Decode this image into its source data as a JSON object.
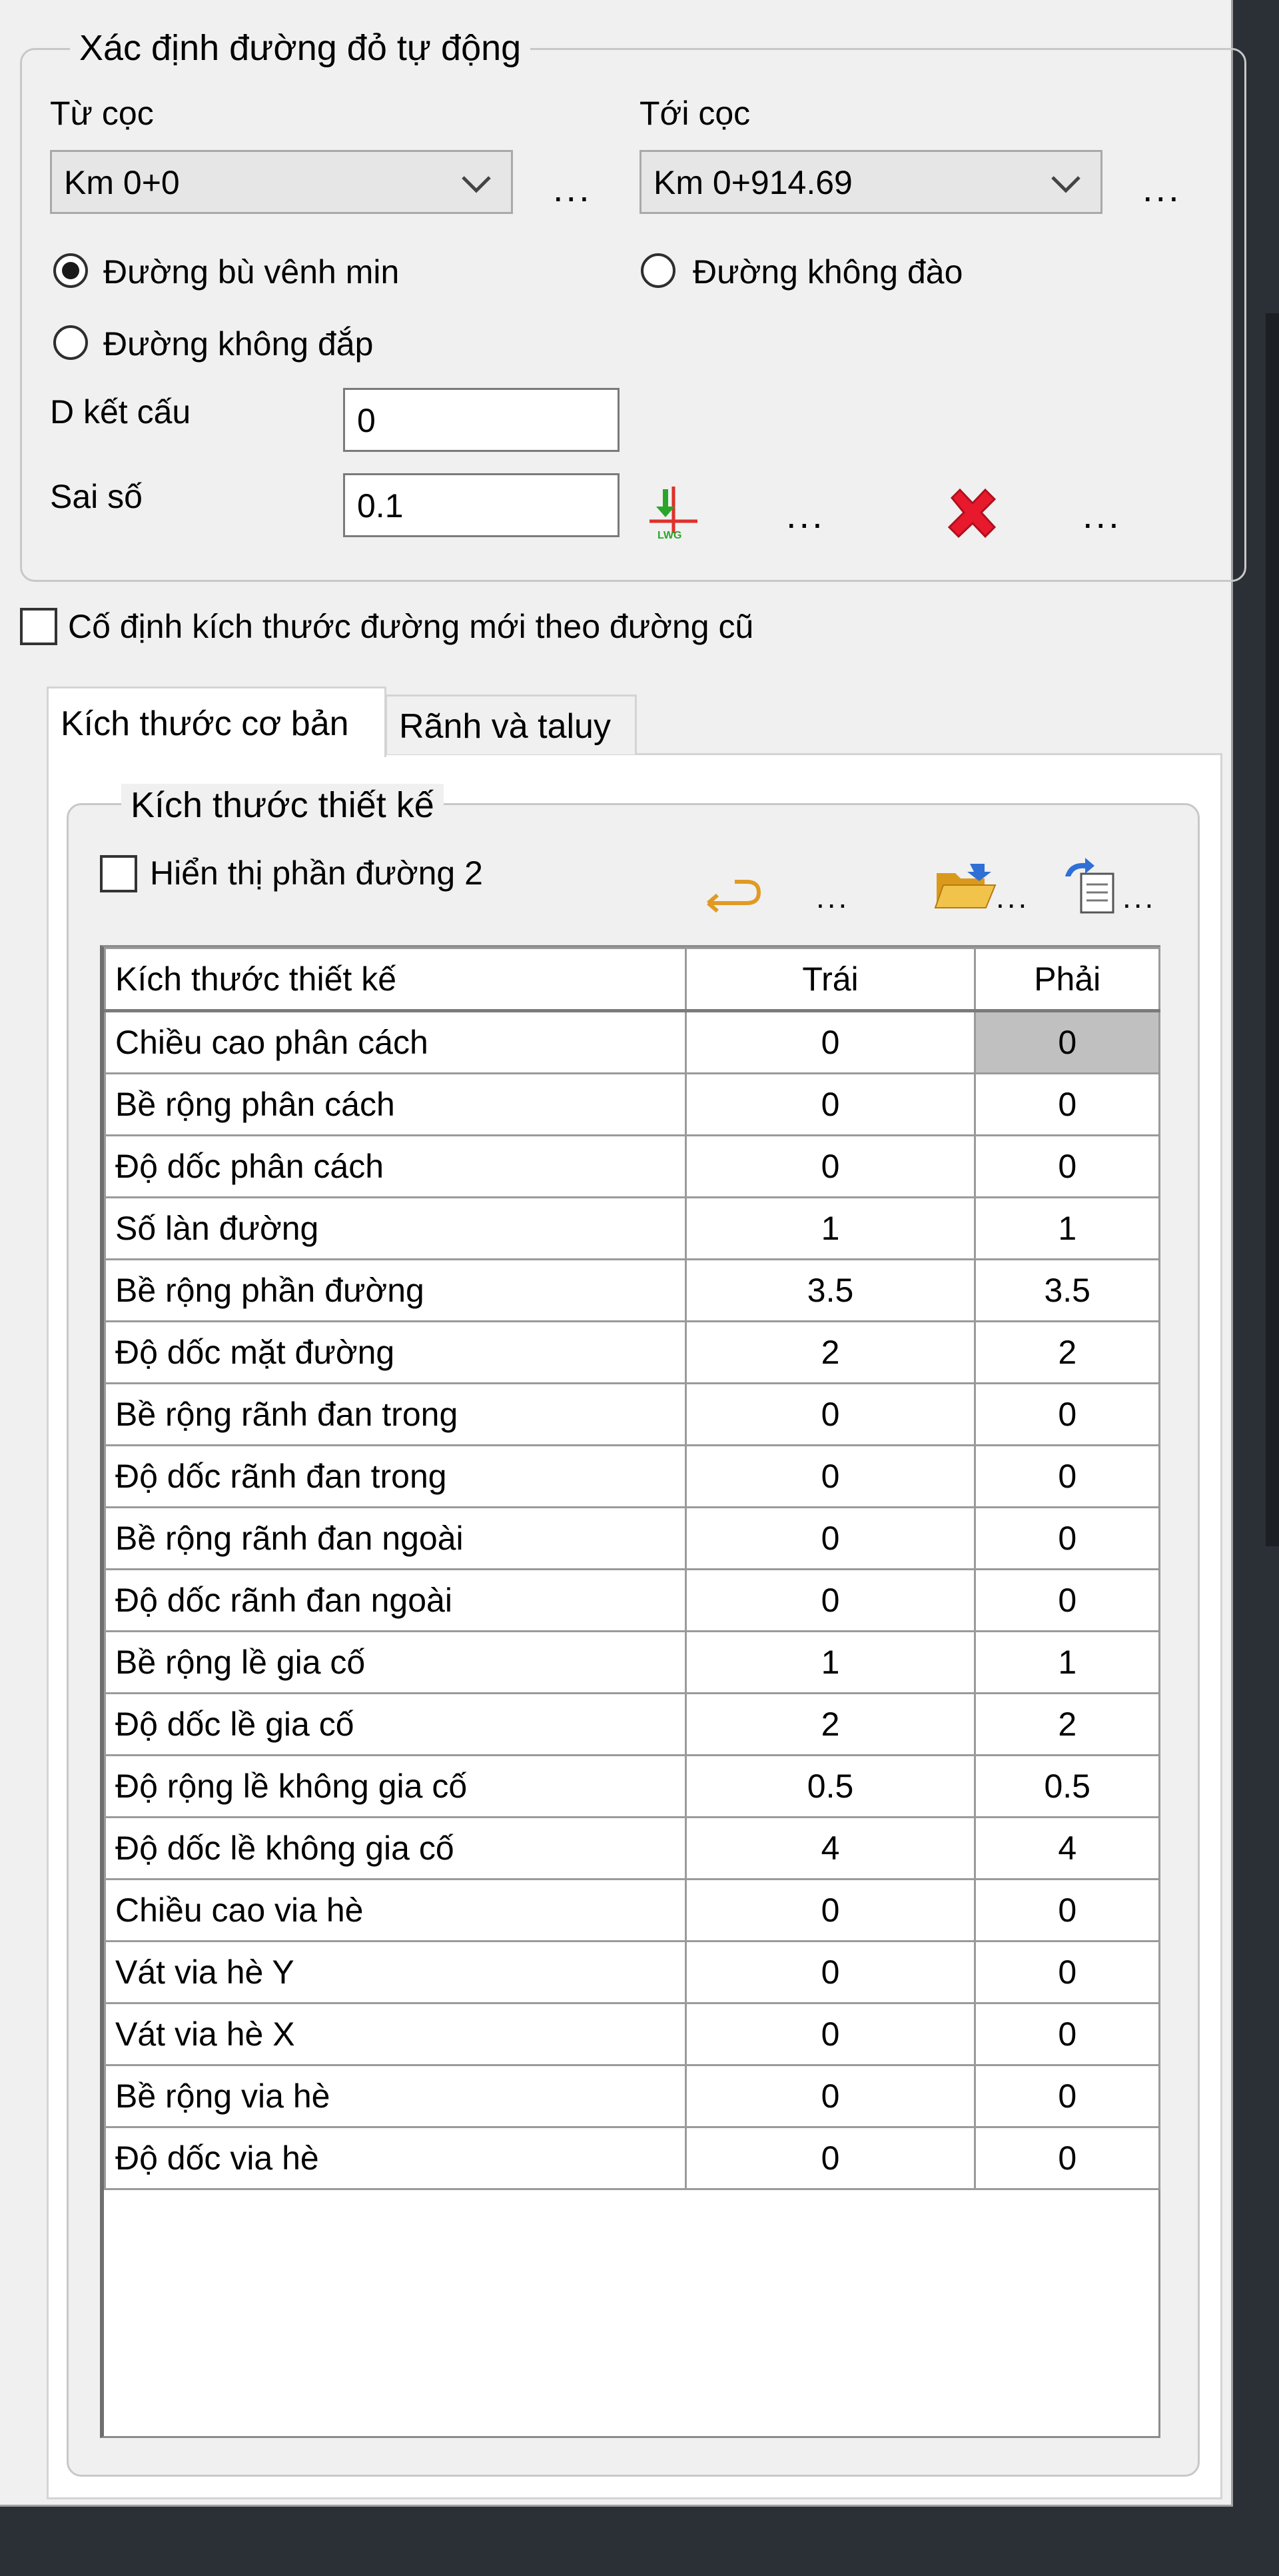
{
  "auto_group": {
    "title": "Xác định đường đỏ tự động",
    "from_label": "Từ cọc",
    "from_value": "Km 0+0",
    "to_label": "Tới cọc",
    "to_value": "Km 0+914.69",
    "ellipsis": "...",
    "radio_min_label": "Đường bù vênh min",
    "radio_no_cut_label": "Đường không đào",
    "radio_no_fill_label": "Đường không đắp",
    "radio_selected": "Đường bù vênh min",
    "structure_label": "D kết cấu",
    "structure_value": "0",
    "tolerance_label": "Sai số",
    "tolerance_value": "0.1"
  },
  "fix_size_label": "Cố định kích thước đường mới theo đường cũ",
  "tabs": [
    {
      "label": "Kích thước cơ bản",
      "active": true
    },
    {
      "label": "Rãnh và taluy",
      "active": false
    }
  ],
  "design_group": {
    "title": "Kích thước thiết kế",
    "show_part2_label": "Hiển thị phần đường 2",
    "ellipsis": "..."
  },
  "table": {
    "headers": [
      "Kích thước thiết kế",
      "Trái",
      "Phải"
    ],
    "rows": [
      [
        "Chiều cao phân cách",
        "0",
        "0"
      ],
      [
        "Bề rộng phân cách",
        "0",
        "0"
      ],
      [
        "Độ dốc phân cách",
        "0",
        "0"
      ],
      [
        "Số làn đường",
        "1",
        "1"
      ],
      [
        "Bề rộng phần đường",
        "3.5",
        "3.5"
      ],
      [
        "Độ dốc mặt đường",
        "2",
        "2"
      ],
      [
        "Bề rộng rãnh đan trong",
        "0",
        "0"
      ],
      [
        "Độ dốc rãnh đan trong",
        "0",
        "0"
      ],
      [
        "Bề rộng rãnh đan ngoài",
        "0",
        "0"
      ],
      [
        "Độ dốc rãnh đan ngoài",
        "0",
        "0"
      ],
      [
        "Bề rộng lề gia cố",
        "1",
        "1"
      ],
      [
        "Độ dốc lề gia cố",
        "2",
        "2"
      ],
      [
        "Độ rộng lề không gia cố",
        "0.5",
        "0.5"
      ],
      [
        "Độ dốc lề không gia cố",
        "4",
        "4"
      ],
      [
        "Chiều cao via hè",
        "0",
        "0"
      ],
      [
        "Vát via hè Y",
        "0",
        "0"
      ],
      [
        "Vát via hè X",
        "0",
        "0"
      ],
      [
        "Bề rộng via hè",
        "0",
        "0"
      ],
      [
        "Độ dốc via hè",
        "0",
        "0"
      ]
    ]
  },
  "colors": {
    "panel_bg": "#f0f0f0",
    "window_bg": "#2b2f36",
    "selected_cell": "#c0c0c0",
    "delete_icon": "#e8192c",
    "apply_icon_green": "#2aa52a",
    "apply_icon_red": "#e0302a",
    "folder_icon": "#f2b630",
    "paste_icon": "#2f6fd6"
  },
  "icons": [
    "chevron-down-icon",
    "apply-lwg-icon",
    "delete-x-icon",
    "undo-arrow-icon",
    "open-folder-icon",
    "paste-icon"
  ]
}
